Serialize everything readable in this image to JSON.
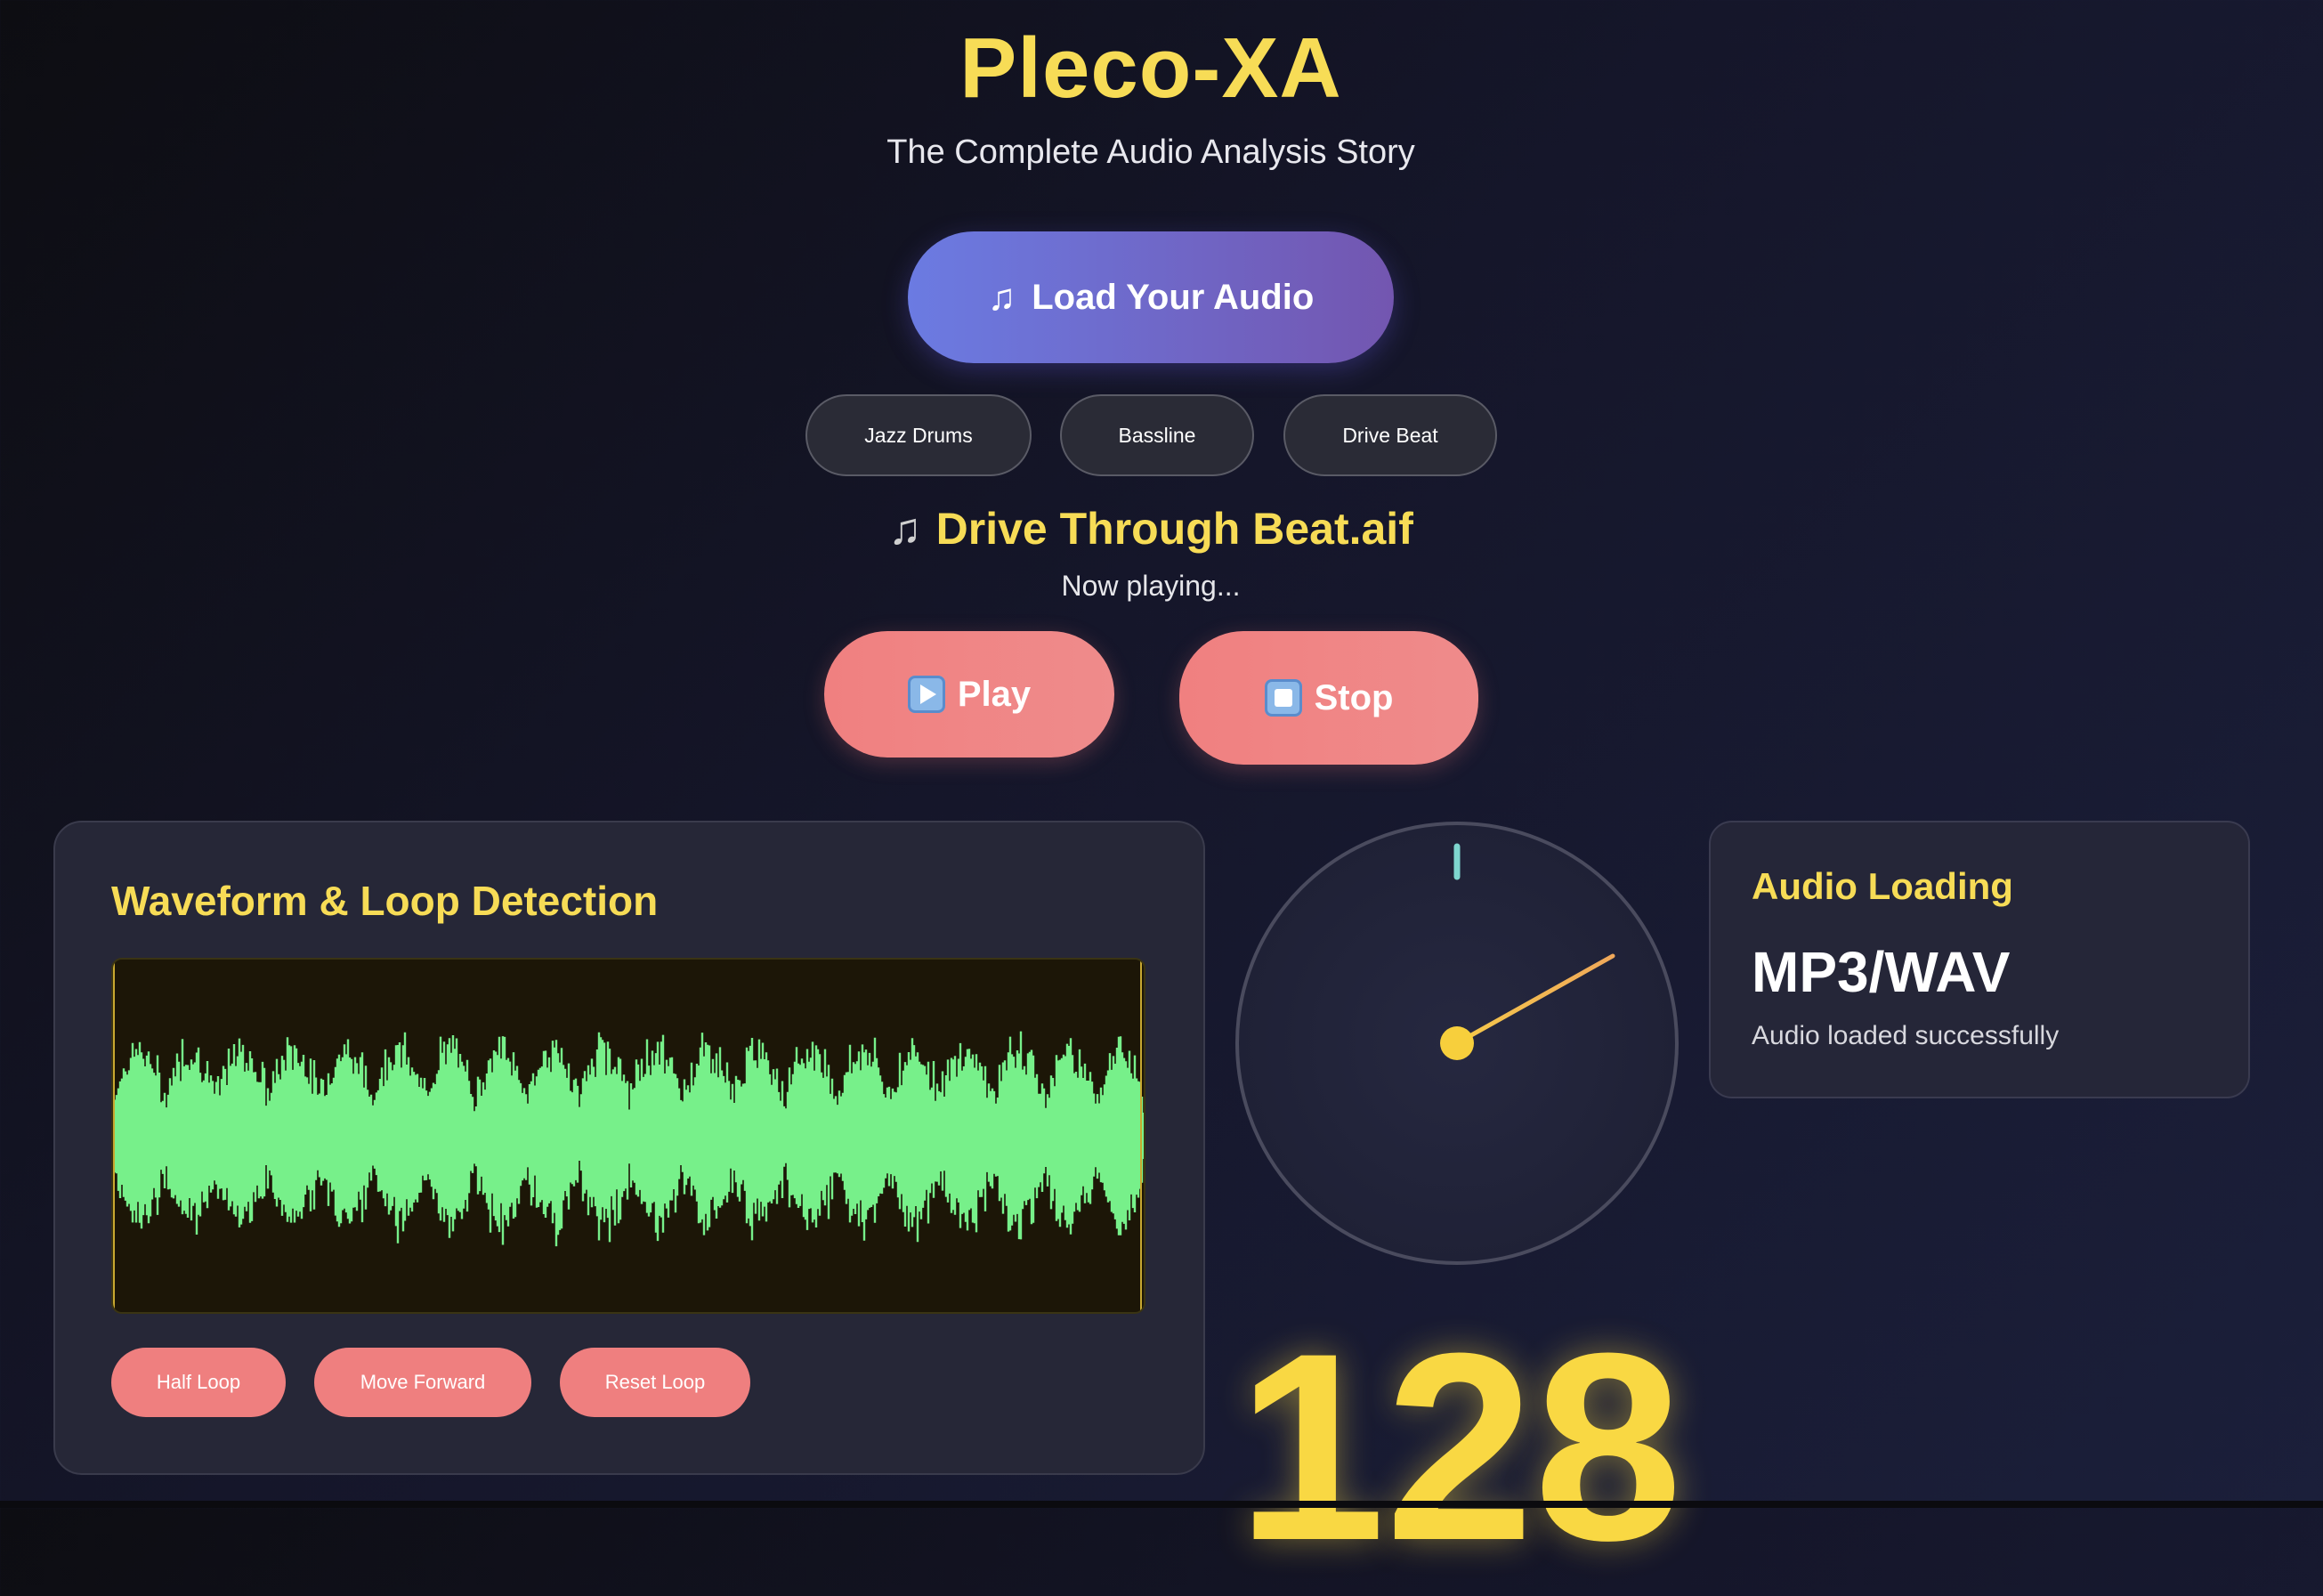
{
  "header": {
    "title": "Pleco-XA",
    "subtitle": "The Complete Audio Analysis Story"
  },
  "load_button": {
    "icon": "music-note-icon",
    "label": "Load Your Audio"
  },
  "presets": [
    {
      "label": "Jazz Drums"
    },
    {
      "label": "Bassline"
    },
    {
      "label": "Drive Beat"
    }
  ],
  "track": {
    "icon": "music-note-icon",
    "name": "Drive Through Beat.aif",
    "status": "Now playing..."
  },
  "transport": {
    "play_label": "Play",
    "stop_label": "Stop"
  },
  "waveform_panel": {
    "title": "Waveform & Loop Detection",
    "wave_color": "#77f08a",
    "buttons": [
      {
        "label": "Half Loop"
      },
      {
        "label": "Move Forward"
      },
      {
        "label": "Reset Loop"
      }
    ]
  },
  "tempo_dial": {
    "needle_color": "#f2b64a",
    "marker_color": "#7ed6cf"
  },
  "info_card": {
    "heading": "Audio Loading",
    "value": "MP3/WAV",
    "status": "Audio loaded successfully"
  },
  "bpm": {
    "value": "128"
  },
  "colors": {
    "accent_yellow": "#f7dc56",
    "button_coral": "#ef7f7f",
    "button_purple": "#6b7be2"
  }
}
